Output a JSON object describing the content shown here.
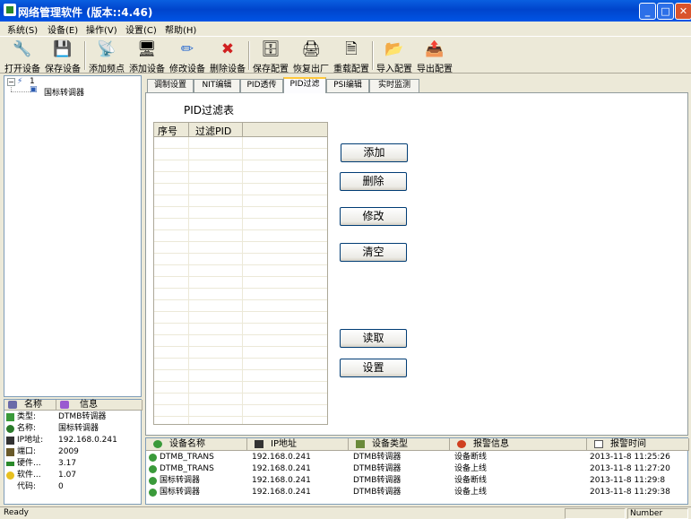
{
  "window": {
    "title": "网络管理软件 (版本::4.46)"
  },
  "menu": [
    "系统(S)",
    "设备(E)",
    "操作(V)",
    "设置(C)",
    "帮助(H)"
  ],
  "toolbar": [
    {
      "label": "打开设备",
      "icon": "open-device-icon",
      "glyph": "🔧"
    },
    {
      "label": "保存设备",
      "icon": "save-device-icon",
      "glyph": "💾"
    },
    {
      "label": "添加频点",
      "icon": "add-frequency-icon",
      "glyph": "📡"
    },
    {
      "label": "添加设备",
      "icon": "add-device-icon",
      "glyph": "🖥"
    },
    {
      "label": "修改设备",
      "icon": "edit-device-icon",
      "glyph": "✏"
    },
    {
      "label": "删除设备",
      "icon": "delete-device-icon",
      "glyph": "✖"
    },
    {
      "label": "保存配置",
      "icon": "save-config-icon",
      "glyph": "🗄"
    },
    {
      "label": "恢复出厂",
      "icon": "factory-reset-icon",
      "glyph": "🖨"
    },
    {
      "label": "重载配置",
      "icon": "reload-config-icon",
      "glyph": "🗎"
    },
    {
      "label": "导入配置",
      "icon": "import-config-icon",
      "glyph": "📂"
    },
    {
      "label": "导出配置",
      "icon": "export-config-icon",
      "glyph": "📤"
    }
  ],
  "tree": {
    "root": "1",
    "child": "国标转调器"
  },
  "props": {
    "header_name": "名称",
    "header_info": "信息",
    "rows": [
      {
        "key": "类型:",
        "value": "DTMB转调器",
        "icon": "type-icon",
        "color": "#3a9a3a"
      },
      {
        "key": "名称:",
        "value": "国标转调器",
        "icon": "name-icon",
        "color": "#2a7a2a"
      },
      {
        "key": "IP地址:",
        "value": "192.168.0.241",
        "icon": "ip-icon",
        "color": "#333333"
      },
      {
        "key": "端口:",
        "value": "2009",
        "icon": "port-icon",
        "color": "#6a5a2a"
      },
      {
        "key": "硬件...",
        "value": "3.17",
        "icon": "hardware-icon",
        "color": "#2a8a2a"
      },
      {
        "key": "软件...",
        "value": "1.07",
        "icon": "software-icon",
        "color": "#e8c020"
      },
      {
        "key": "代码:",
        "value": "0",
        "icon": "",
        "color": ""
      }
    ]
  },
  "tabs": [
    "调制设置",
    "NIT编辑",
    "PID透传",
    "PID过滤",
    "PSI编辑",
    "实时监测"
  ],
  "active_tab": 3,
  "pid_filter": {
    "title": "PID过滤表",
    "col_index": "序号",
    "col_pid": "过滤PID",
    "buttons": {
      "add": "添加",
      "delete": "删除",
      "modify": "修改",
      "clear": "清空",
      "read": "读取",
      "set": "设置"
    }
  },
  "alarms": {
    "headers": [
      "设备名称",
      "IP地址",
      "设备类型",
      "报警信息",
      "报警时间"
    ],
    "rows": [
      {
        "device": "DTMB_TRANS",
        "ip": "192.168.0.241",
        "type": "DTMB转调器",
        "info": "设备断线",
        "time": "2013-11-8 11:25:26"
      },
      {
        "device": "DTMB_TRANS",
        "ip": "192.168.0.241",
        "type": "DTMB转调器",
        "info": "设备上线",
        "time": "2013-11-8 11:27:20"
      },
      {
        "device": "国标转调器",
        "ip": "192.168.0.241",
        "type": "DTMB转调器",
        "info": "设备断线",
        "time": "2013-11-8 11:29:8"
      },
      {
        "device": "国标转调器",
        "ip": "192.168.0.241",
        "type": "DTMB转调器",
        "info": "设备上线",
        "time": "2013-11-8 11:29:38"
      }
    ]
  },
  "status": {
    "left": "Ready",
    "right": "Number"
  }
}
